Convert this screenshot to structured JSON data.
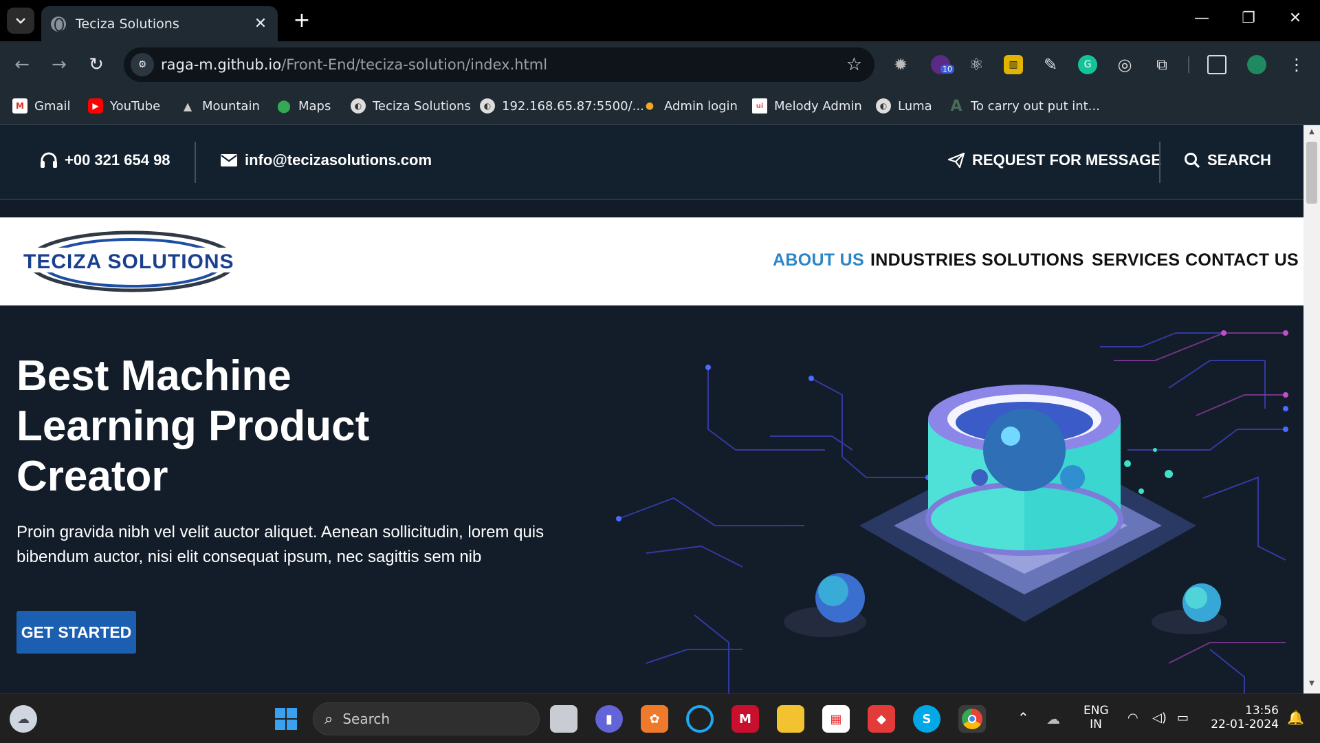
{
  "browser": {
    "tab_title": "Teciza Solutions",
    "url_host": "raga-m.github.io",
    "url_path": "/Front-End/teciza-solution/index.html",
    "extension_badge": "10",
    "bookmarks": [
      {
        "label": "Gmail",
        "icon": "gmail-icon"
      },
      {
        "label": "YouTube",
        "icon": "youtube-icon"
      },
      {
        "label": "Mountain",
        "icon": "mountain-icon"
      },
      {
        "label": "Maps",
        "icon": "maps-icon"
      },
      {
        "label": "Teciza Solutions",
        "icon": "globe-icon"
      },
      {
        "label": "192.168.65.87:5500/...",
        "icon": "globe-icon"
      },
      {
        "label": "Admin login",
        "icon": "admin-icon"
      },
      {
        "label": "Melody Admin",
        "icon": "melody-icon"
      },
      {
        "label": "Luma",
        "icon": "globe-icon"
      },
      {
        "label": "To carry out put int...",
        "icon": "font-icon"
      }
    ]
  },
  "topbar": {
    "phone": "+00 321 654 98",
    "email": "info@tecizasolutions.com",
    "request": "REQUEST FOR MESSAGE",
    "search": "SEARCH"
  },
  "navbar": {
    "logo_text": "TECIZA SOLUTIONS",
    "links": [
      "ABOUT US",
      "INDUSTRIES",
      "SOLUTIONS",
      "SERVICES",
      "CONTACT US"
    ],
    "active_link": "ABOUT US"
  },
  "hero": {
    "title_lines": [
      "Best Machine",
      "Learning Product",
      "Creator"
    ],
    "description": "Proin gravida nibh vel velit auctor aliquet. Aenean sollicitudin, lorem quis bibendum auctor, nisi elit consequat ipsum, nec sagittis sem nib",
    "cta": "GET STARTED"
  },
  "taskbar": {
    "search_placeholder": "Search",
    "lang_line1": "ENG",
    "lang_line2": "IN",
    "time": "13:56",
    "date": "22-01-2024"
  },
  "colors": {
    "accent_blue": "#2c86c6",
    "page_dark": "#121d29",
    "cta_blue": "#1c5fb0"
  }
}
